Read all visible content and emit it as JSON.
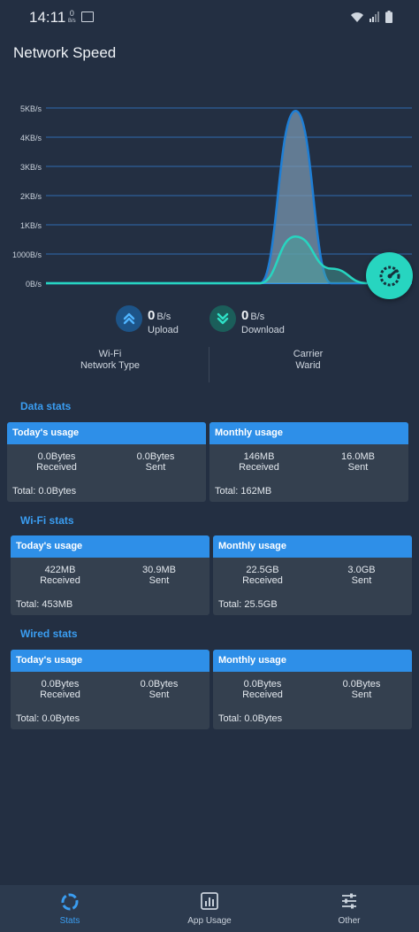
{
  "status_bar": {
    "time": "14:11",
    "small_top": "0",
    "small_bottom": "B/s"
  },
  "header": {
    "title": "Network Speed"
  },
  "chart_data": {
    "type": "area",
    "y_tick_labels": [
      "5KB/s",
      "4KB/s",
      "3KB/s",
      "2KB/s",
      "1KB/s",
      "1000B/s",
      "0B/s"
    ],
    "ylim": [
      0,
      6
    ],
    "series": [
      {
        "name": "Upload",
        "color": "#1e7fd6",
        "x": [
          0,
          1,
          2,
          3,
          4,
          5,
          6,
          7,
          8,
          9
        ],
        "values": [
          0,
          0,
          0,
          0,
          0,
          0,
          0,
          5.9,
          0,
          0
        ]
      },
      {
        "name": "Download",
        "color": "#27d5c0",
        "x": [
          0,
          1,
          2,
          3,
          4,
          5,
          6,
          7,
          8,
          9
        ],
        "values": [
          0,
          0,
          0,
          0,
          0,
          0,
          0,
          1.6,
          0.5,
          0
        ]
      }
    ],
    "grid": true
  },
  "speeds": {
    "upload": {
      "value": "0",
      "unit": "B/s",
      "label": "Upload"
    },
    "download": {
      "value": "0",
      "unit": "B/s",
      "label": "Download"
    }
  },
  "network_info": {
    "left_line1": "Wi-Fi",
    "left_line2": "Network Type",
    "right_line1": "Carrier",
    "right_line2": "Warid"
  },
  "sections": {
    "data_stats": {
      "title": "Data stats",
      "today": {
        "title": "Today's usage",
        "received_value": "0.0Bytes",
        "received_label": "Received",
        "sent_value": "0.0Bytes",
        "sent_label": "Sent",
        "total": "Total: 0.0Bytes"
      },
      "monthly": {
        "title": "Monthly usage",
        "received_value": "146MB",
        "received_label": "Received",
        "sent_value": "16.0MB",
        "sent_label": "Sent",
        "total": "Total: 162MB"
      }
    },
    "wifi_stats": {
      "title": "Wi-Fi stats",
      "today": {
        "title": "Today's usage",
        "received_value": "422MB",
        "received_label": "Received",
        "sent_value": "30.9MB",
        "sent_label": "Sent",
        "total": "Total: 453MB"
      },
      "monthly": {
        "title": "Monthly usage",
        "received_value": "22.5GB",
        "received_label": "Received",
        "sent_value": "3.0GB",
        "sent_label": "Sent",
        "total": "Total: 25.5GB"
      }
    },
    "wired_stats": {
      "title": "Wired stats",
      "today": {
        "title": "Today's usage",
        "received_value": "0.0Bytes",
        "received_label": "Received",
        "sent_value": "0.0Bytes",
        "sent_label": "Sent",
        "total": "Total: 0.0Bytes"
      },
      "monthly": {
        "title": "Monthly usage",
        "received_value": "0.0Bytes",
        "received_label": "Received",
        "sent_value": "0.0Bytes",
        "sent_label": "Sent",
        "total": "Total: 0.0Bytes"
      }
    }
  },
  "bottom_nav": {
    "items": [
      {
        "label": "Stats",
        "icon": "stats-ring-icon",
        "active": true
      },
      {
        "label": "App Usage",
        "icon": "bar-chart-icon",
        "active": false
      },
      {
        "label": "Other",
        "icon": "sliders-icon",
        "active": false
      }
    ]
  },
  "colors": {
    "background": "#232f42",
    "accent": "#2e8fe8",
    "teal": "#27d5c0"
  }
}
